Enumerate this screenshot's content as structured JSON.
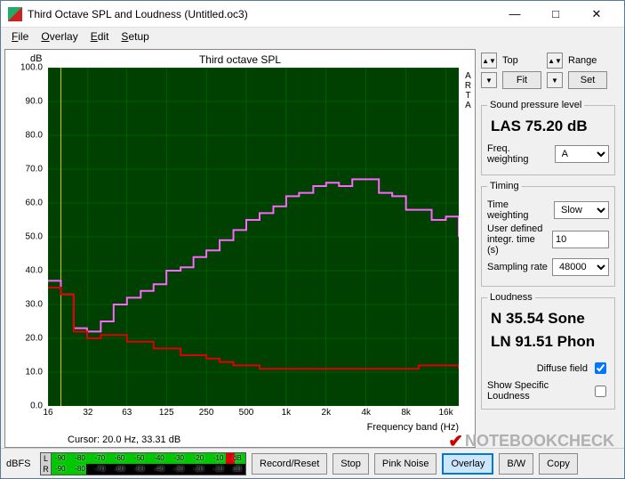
{
  "window": {
    "title": "Third Octave SPL and Loudness (Untitled.oc3)"
  },
  "menu": {
    "file": "File",
    "overlay": "Overlay",
    "edit": "Edit",
    "setup": "Setup"
  },
  "chart": {
    "title": "Third octave SPL",
    "ylabel": "dB",
    "arta": "ARTA",
    "xlabel": "Frequency band (Hz)",
    "cursor": "Cursor:   20.0 Hz, 33.31 dB"
  },
  "chart_data": {
    "type": "line",
    "title": "Third octave SPL",
    "xlabel": "Frequency band (Hz)",
    "ylabel": "dB",
    "ylim": [
      0,
      100
    ],
    "x_ticks": [
      "16",
      "32",
      "63",
      "125",
      "250",
      "500",
      "1k",
      "2k",
      "4k",
      "8k",
      "16k"
    ],
    "y_ticks": [
      0,
      10,
      20,
      30,
      40,
      50,
      60,
      70,
      80,
      90,
      100
    ],
    "x": [
      16,
      20,
      25,
      31.5,
      40,
      50,
      63,
      80,
      100,
      125,
      160,
      200,
      250,
      315,
      400,
      500,
      630,
      800,
      1000,
      1250,
      1600,
      2000,
      2500,
      3150,
      4000,
      5000,
      6300,
      8000,
      10000,
      12500,
      16000,
      20000
    ],
    "series": [
      {
        "name": "pink",
        "color": "#ff66ff",
        "values": [
          37,
          33,
          23,
          22,
          25,
          30,
          32,
          34,
          36,
          40,
          41,
          44,
          46,
          49,
          52,
          55,
          57,
          59,
          62,
          63,
          65,
          66,
          65,
          67,
          67,
          63,
          62,
          58,
          58,
          55,
          56,
          50
        ]
      },
      {
        "name": "red",
        "color": "#e00000",
        "values": [
          35,
          33,
          22,
          20,
          21,
          21,
          19,
          19,
          17,
          17,
          15,
          15,
          14,
          13,
          12,
          12,
          11,
          11,
          11,
          11,
          11,
          11,
          11,
          11,
          11,
          11,
          11,
          11,
          12,
          12,
          12,
          11
        ]
      }
    ]
  },
  "side": {
    "top_label1": "Top",
    "top_label2": "Range",
    "fit_btn": "Fit",
    "set_btn": "Set"
  },
  "spl": {
    "legend": "Sound pressure level",
    "value": "LAS 75.20 dB",
    "freq_weight_label": "Freq. weighting",
    "freq_weight_value": "A"
  },
  "timing": {
    "legend": "Timing",
    "time_weight_label": "Time weighting",
    "time_weight_value": "Slow",
    "integr_label": "User defined integr. time (s)",
    "integr_value": "10",
    "sampling_label": "Sampling rate",
    "sampling_value": "48000"
  },
  "loudness": {
    "legend": "Loudness",
    "sone": "N 35.54 Sone",
    "phon": "LN 91.51 Phon",
    "diffuse_label": "Diffuse field",
    "diffuse_checked": true,
    "specific_label": "Show Specific Loudness",
    "specific_checked": false
  },
  "bottom": {
    "dbfs": "dBFS",
    "meter_ticks": [
      "-90",
      "-80",
      "-70",
      "-60",
      "-50",
      "-40",
      "-30",
      "-20",
      "-10",
      "dB"
    ],
    "ch_l": "L",
    "ch_r": "R",
    "btn_record": "Record/Reset",
    "btn_stop": "Stop",
    "btn_pink": "Pink Noise",
    "btn_overlay": "Overlay",
    "btn_bw": "B/W",
    "btn_copy": "Copy"
  },
  "watermark": "NOTEBOOKCHECK"
}
